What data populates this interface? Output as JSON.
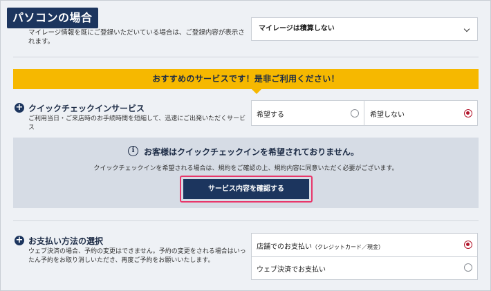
{
  "section_tag": "パソコンの場合",
  "mileage": {
    "description": "マイレージ情報を既にご登録いただいている場合は、ご登録内容が表示されます。",
    "selected_value": "マイレージは積算しない"
  },
  "banner": "おすすめのサービスです！是非ご利用ください！",
  "quick_checkin": {
    "title": "クイックチェックインサービス",
    "description": "ご利用当日・ご来店時のお手続時間を短縮して、迅速にご出発いただくサービス",
    "options": [
      {
        "label": "希望する",
        "selected": false
      },
      {
        "label": "希望しない",
        "selected": true
      }
    ]
  },
  "notice": {
    "title": "お客様はクイックチェックインを希望されておりません。",
    "description": "クイックチェックインを希望される場合は、規約をご確認の上、規約内容に同意いただく必要がございます。",
    "button_label": "サービス内容を確認する"
  },
  "payment": {
    "title": "お支払い方法の選択",
    "description": "ウェブ決済の場合、予約の変更はできません。予約の変更をされる場合はいったん予約をお取り消しいただき、再度ご予約をお願いいたします。",
    "options": [
      {
        "label": "店舗でのお支払い",
        "note": "（クレジットカード／現金）",
        "selected": true
      },
      {
        "label": "ウェブ決済でお支払い",
        "note": "",
        "selected": false
      }
    ]
  },
  "colors": {
    "navy": "#1c355e",
    "banner_yellow": "#f6b800",
    "radio_selected": "#b3152b",
    "highlight_border": "#e8366a"
  },
  "icons": {
    "plus": "plus-circle-icon",
    "info": "info-icon",
    "chevron": "chevron-down-icon"
  }
}
